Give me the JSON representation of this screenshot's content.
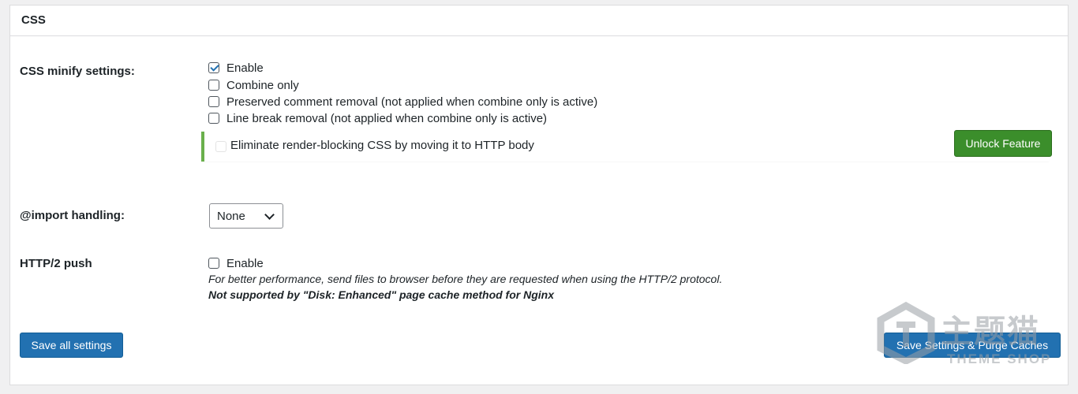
{
  "panel": {
    "title": "CSS"
  },
  "minify": {
    "label": "CSS minify settings:",
    "options": [
      {
        "label": "Enable",
        "checked": true
      },
      {
        "label": "Combine only",
        "checked": false
      },
      {
        "label": "Preserved comment removal (not applied when combine only is active)",
        "checked": false
      },
      {
        "label": "Line break removal (not applied when combine only is active)",
        "checked": false
      }
    ],
    "pro_option": {
      "label": "Eliminate render-blocking CSS by moving it to HTTP body",
      "checked": false
    },
    "unlock_label": "Unlock Feature"
  },
  "import": {
    "label": "@import handling:",
    "selected": "None"
  },
  "http2": {
    "label": "HTTP/2 push",
    "option": {
      "label": "Enable",
      "checked": false
    },
    "desc1": "For better performance, send files to browser before they are requested when using the HTTP/2 protocol.",
    "desc2": "Not supported by \"Disk: Enhanced\" page cache method for Nginx"
  },
  "buttons": {
    "save_all": "Save all settings",
    "save_purge": "Save Settings & Purge Caches"
  },
  "watermark": {
    "cn": "主题猫",
    "en": "THEME SHOP"
  },
  "colors": {
    "accent": "#2271b1",
    "unlock": "#3b8e2b",
    "pro_border": "#6ab04c"
  }
}
